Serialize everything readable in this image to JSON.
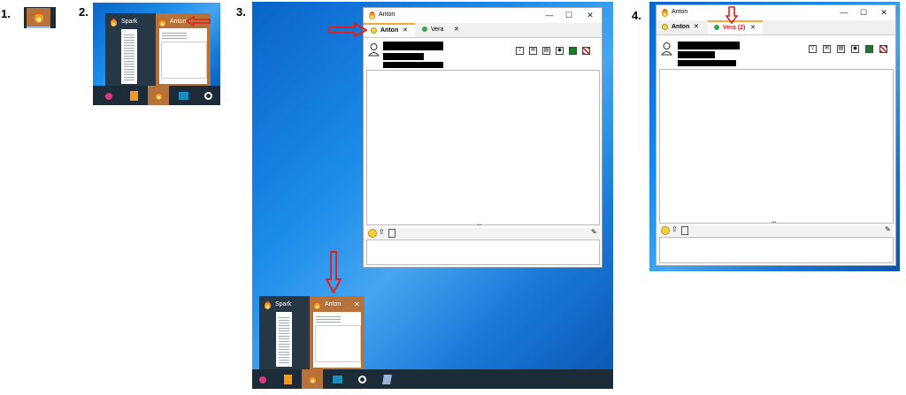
{
  "steps": {
    "one": "1.",
    "two": "2.",
    "three": "3.",
    "four": "4."
  },
  "taskbar_previews": {
    "spark_label": "Spark",
    "anton_label": "Anton"
  },
  "window": {
    "title": "Anton",
    "minimize": "—",
    "maximize": "☐",
    "close": "✕"
  },
  "tabs_step3": [
    {
      "label": "Anton",
      "close": "✕",
      "status": "away"
    },
    {
      "label": "Vera",
      "close": "✕",
      "status": "online"
    }
  ],
  "tabs_step4": [
    {
      "label": "Anton",
      "close": "✕",
      "status": "away"
    },
    {
      "label": "Vera (2)",
      "close": "✕",
      "status": "online"
    }
  ],
  "divider_grip": "•••",
  "colors": {
    "arrow_red": "#e02020",
    "tab_accent": "#f3a93b",
    "away_yellow": "#f3d34a",
    "online_green": "#2ea84a",
    "desktop_blue": "#1b8bea",
    "taskbar_dark": "#1c2b38",
    "preview_orange": "#b5723a"
  },
  "icons": [
    "flame-icon",
    "avatar-icon",
    "send-file-icon",
    "open-box-icon",
    "document-icon",
    "screenshot-icon",
    "qr-icon",
    "emoji-icon",
    "upload-icon",
    "note-icon",
    "mute-icon"
  ]
}
